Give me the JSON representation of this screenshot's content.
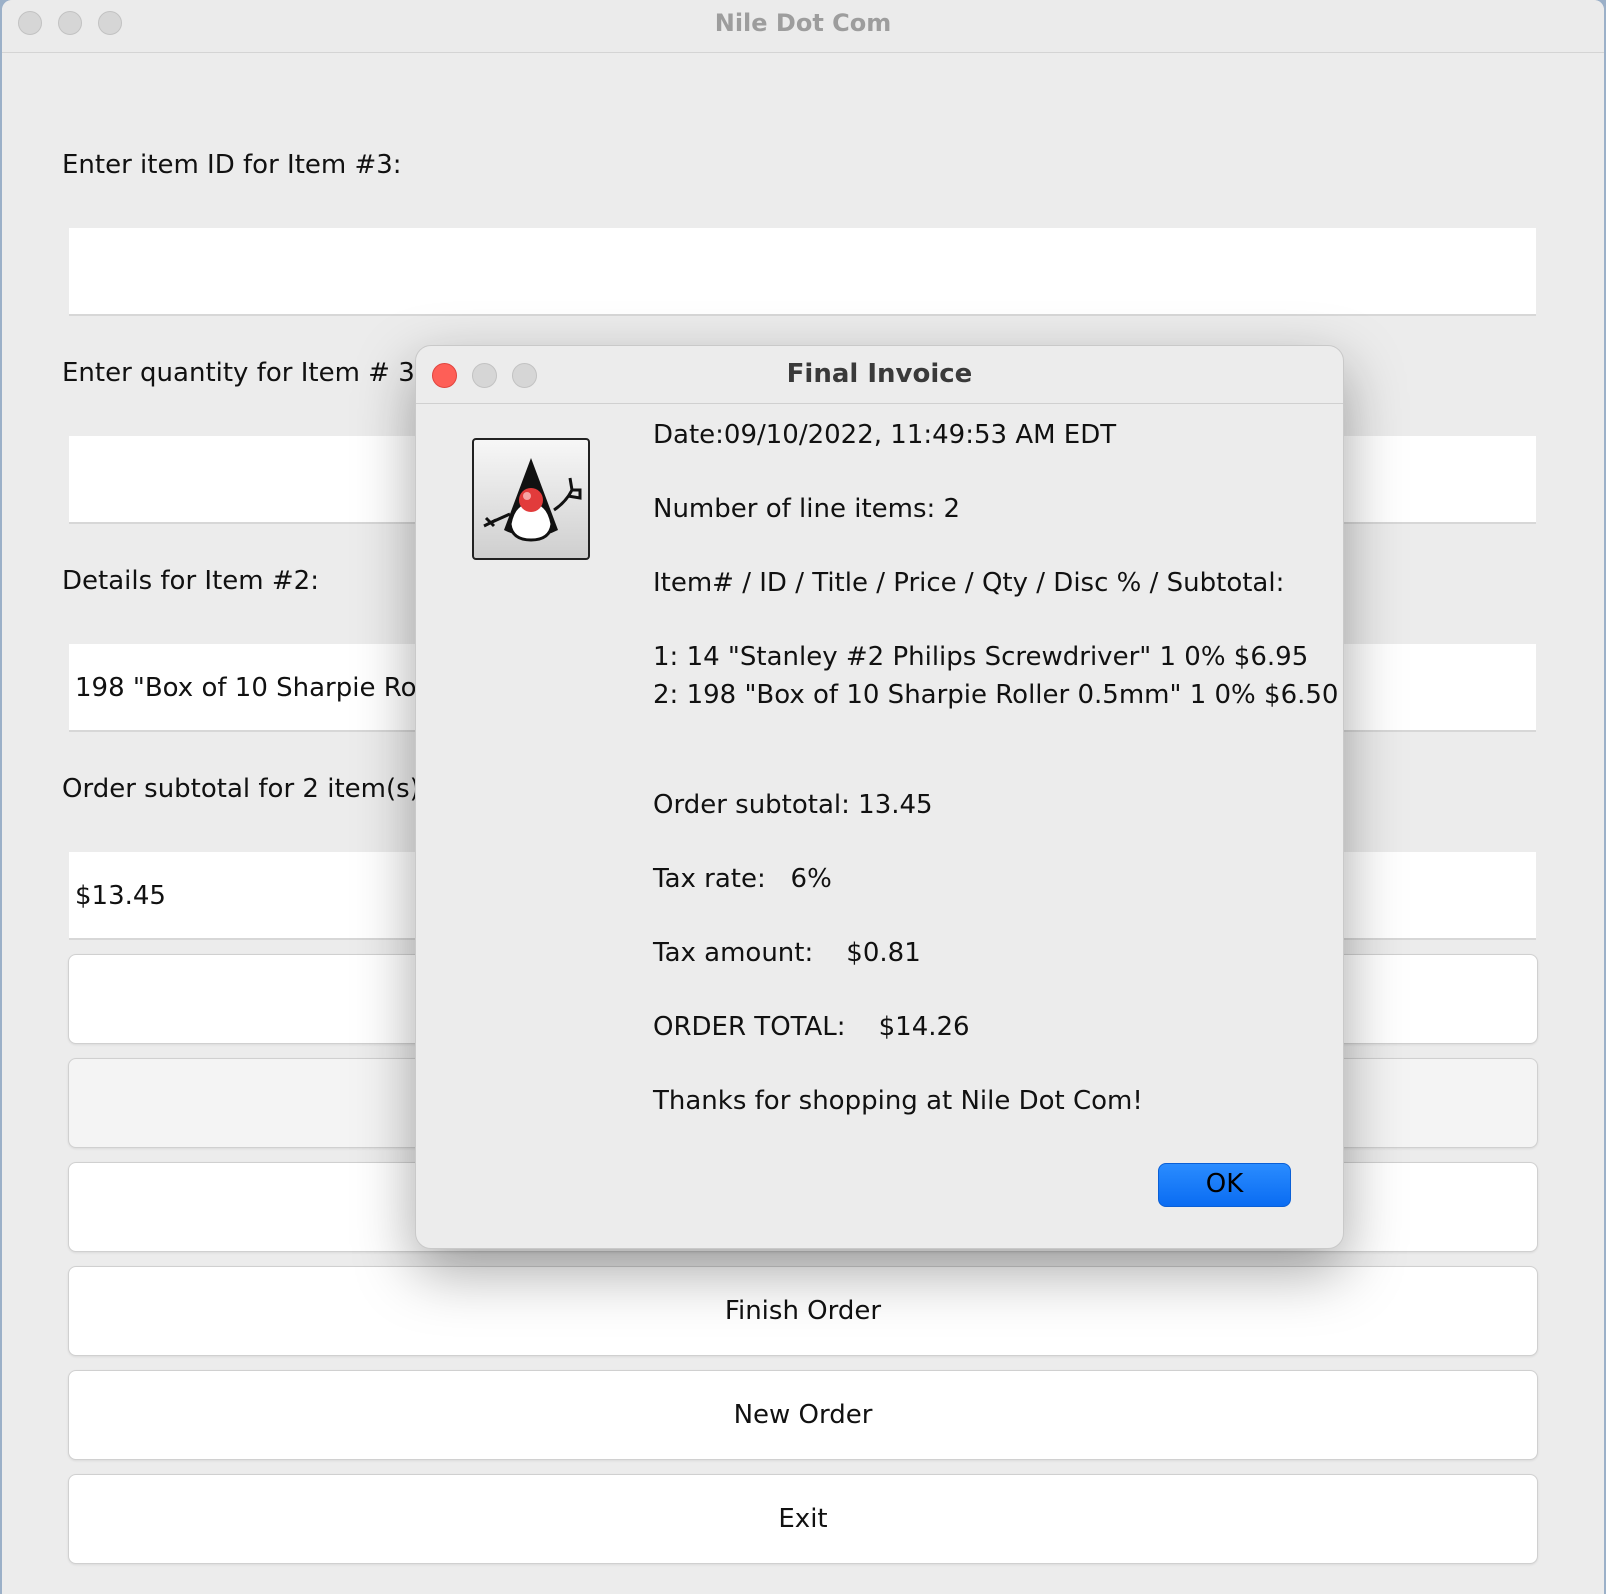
{
  "window": {
    "title": "Nile Dot Com"
  },
  "form": {
    "item_id_label": "Enter item ID for Item #3:",
    "item_id_value": "",
    "quantity_label": "Enter quantity for Item # 3:",
    "quantity_value": "",
    "details_label": "Details for Item #2:",
    "details_value": "198 \"Box of 10 Sharpie Roller 0.5mm\" $6.50 1 0% $6.50",
    "subtotal_label": "Order subtotal for 2 item(s):",
    "subtotal_value": "$13.45"
  },
  "buttons": {
    "finish_order": "Finish Order",
    "new_order": "New Order",
    "exit": "Exit"
  },
  "dialog": {
    "title": "Final Invoice",
    "date": "Date:09/10/2022, 11:49:53 AM EDT",
    "line_items_count": "Number of line items: 2",
    "header": "Item# / ID / Title / Price / Qty / Disc % / Subtotal:",
    "lines": [
      "1: 14 \"Stanley #2 Philips Screwdriver\" 1 0% $6.95",
      "2: 198 \"Box of 10 Sharpie Roller 0.5mm\" 1 0% $6.50"
    ],
    "order_subtotal": "Order subtotal: 13.45",
    "tax_rate": "Tax rate:   6%",
    "tax_amount": "Tax amount:    $0.81",
    "order_total": "ORDER TOTAL:    $14.26",
    "thanks": "Thanks for shopping at Nile Dot Com!",
    "ok_label": "OK"
  },
  "colors": {
    "close": "#fe5f57",
    "ok_button": "#0a6cf2",
    "inactive_light": "#d6d6d6"
  }
}
